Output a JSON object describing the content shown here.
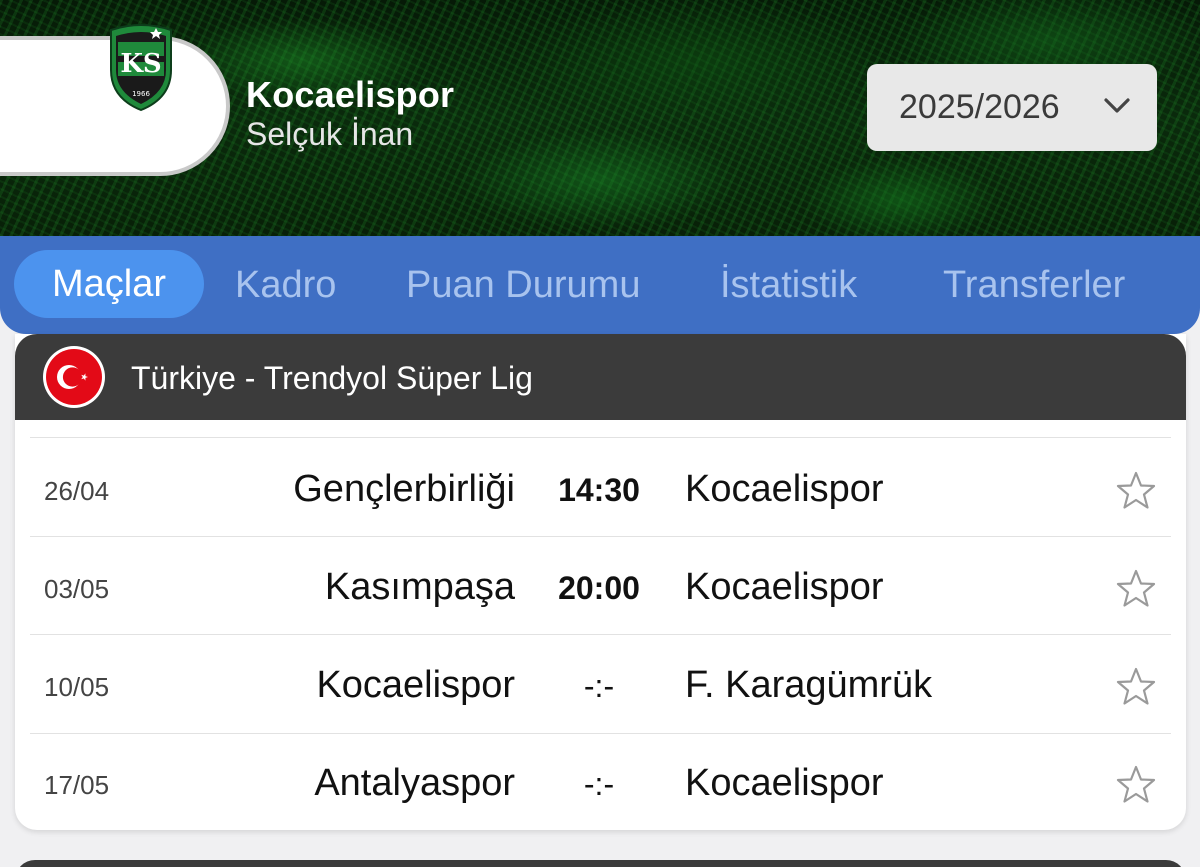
{
  "header": {
    "team_name": "Kocaelispor",
    "coach_name": "Selçuk İnan",
    "season": "2025/2026",
    "crest_text": "KS 1966",
    "colors": {
      "crest_green": "#1f8a3b",
      "crest_black": "#1a1a1a"
    }
  },
  "tabs": [
    {
      "label": "Maçlar",
      "active": true
    },
    {
      "label": "Kadro"
    },
    {
      "label": "Puan Durumu"
    },
    {
      "label": "İstatistik"
    },
    {
      "label": "Transferler"
    }
  ],
  "league": {
    "name": "Türkiye - Trendyol Süper Lig",
    "flag": "turkey-flag-icon"
  },
  "matches": [
    {
      "date": "26/04",
      "home": "Gençlerbirliği",
      "score": "14:30",
      "away": "Kocaelispor"
    },
    {
      "date": "03/05",
      "home": "Kasımpaşa",
      "score": "20:00",
      "away": "Kocaelispor"
    },
    {
      "date": "10/05",
      "home": "Kocaelispor",
      "score": "-:-",
      "away": "F. Karagümrük"
    },
    {
      "date": "17/05",
      "home": "Antalyaspor",
      "score": "-:-",
      "away": "Kocaelispor"
    }
  ],
  "theme": {
    "tabbar": "#3f6fc4",
    "tab_active": "#4c93ee",
    "league_header": "#3b3b3b"
  }
}
